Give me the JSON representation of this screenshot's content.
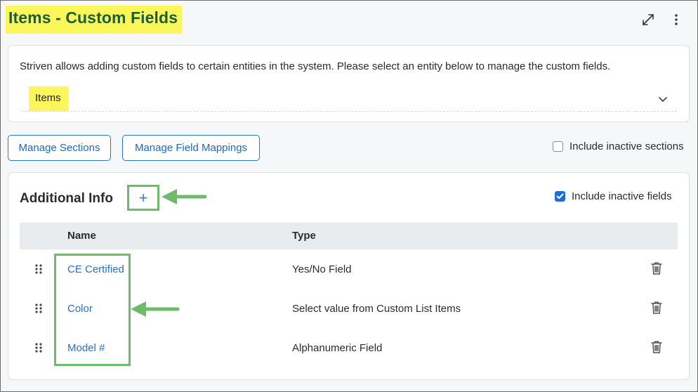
{
  "page": {
    "title": "Items - Custom Fields"
  },
  "toolbar": {
    "icons": [
      "expand-icon",
      "kebab-menu-icon"
    ]
  },
  "entity": {
    "description": "Striven allows adding custom fields to certain entities in the system. Please select an entity below to manage the custom fields.",
    "selected": "Items"
  },
  "actions": {
    "manage_sections": "Manage Sections",
    "manage_field_mappings": "Manage Field Mappings",
    "include_inactive_sections": "Include inactive sections",
    "include_inactive_sections_checked": false
  },
  "section": {
    "title": "Additional Info",
    "add_label": "+",
    "include_inactive_fields": "Include inactive fields",
    "include_inactive_fields_checked": true,
    "columns": [
      "Name",
      "Type"
    ],
    "rows": [
      {
        "name": "CE Certified",
        "type": "Yes/No Field"
      },
      {
        "name": "Color",
        "type": "Select value from Custom List Items"
      },
      {
        "name": "Model #",
        "type": "Alphanumeric Field"
      }
    ]
  },
  "colors": {
    "highlight_yellow": "#fbf75a",
    "title_green": "#1b5e3b",
    "annotation_green": "#6dbb6b",
    "link_blue": "#2a6fc5",
    "checkbox_blue": "#1f6fd1"
  }
}
